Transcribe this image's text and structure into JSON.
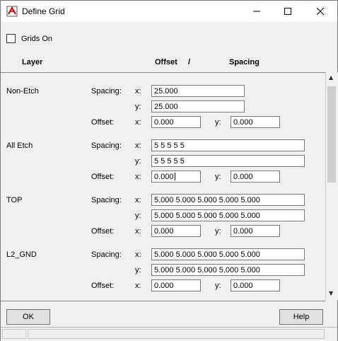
{
  "window": {
    "title": "Define Grid"
  },
  "grids_on": {
    "label": "Grids On",
    "checked": false
  },
  "headers": {
    "layer": "Layer",
    "offset": "Offset",
    "slash": "/",
    "spacing": "Spacing"
  },
  "labels": {
    "spacing": "Spacing:",
    "offset": "Offset:",
    "x": "x:",
    "y": "y:"
  },
  "layers": [
    {
      "name": "Non-Etch",
      "spacing_x": "25.000",
      "spacing_y": "25.000",
      "offset_x": "0.000",
      "offset_y": "0.000"
    },
    {
      "name": "All Etch",
      "spacing_x": "5 5 5 5 5",
      "spacing_y": "5 5 5 5 5",
      "offset_x": "0.000",
      "offset_y": "0.000"
    },
    {
      "name": "TOP",
      "spacing_x": "5.000 5.000 5.000 5.000 5.000",
      "spacing_y": "5.000 5.000 5.000 5.000 5.000",
      "offset_x": "0.000",
      "offset_y": "0.000"
    },
    {
      "name": "L2_GND",
      "spacing_x": "5.000 5.000 5.000 5.000 5.000",
      "spacing_y": "5.000 5.000 5.000 5.000 5.000",
      "offset_x": "0.000",
      "offset_y": "0.000"
    }
  ],
  "buttons": {
    "ok": "OK",
    "help": "Help"
  }
}
